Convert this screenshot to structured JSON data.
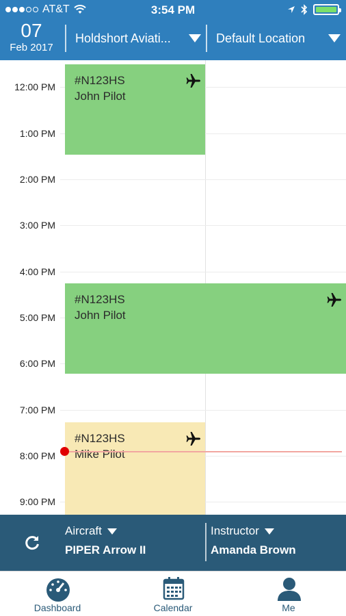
{
  "status_bar": {
    "carrier": "AT&T",
    "time": "3:54 PM"
  },
  "header": {
    "day": "07",
    "month_year": "Feb 2017",
    "org_select": "Holdshort Aviati...",
    "location_select": "Default Location"
  },
  "calendar": {
    "time_labels": [
      "12:00 PM",
      "1:00 PM",
      "2:00 PM",
      "3:00 PM",
      "4:00 PM",
      "5:00 PM",
      "6:00 PM",
      "7:00 PM",
      "8:00 PM",
      "9:00 PM"
    ],
    "events": [
      {
        "tail": "#N123HS",
        "pilot": "John Pilot",
        "color": "#86d07f"
      },
      {
        "tail": "#N123HS",
        "pilot": "John Pilot",
        "color": "#86d07f"
      },
      {
        "tail": "#N123HS",
        "pilot": "Mike Pilot",
        "color": "#f8e9b5"
      }
    ]
  },
  "filters": {
    "aircraft_label": "Aircraft",
    "aircraft_value": "PIPER Arrow II",
    "instructor_label": "Instructor",
    "instructor_value": "Amanda Brown"
  },
  "tabs": [
    {
      "label": "Dashboard",
      "icon": "dashboard-gauge-icon"
    },
    {
      "label": "Calendar",
      "icon": "calendar-icon"
    },
    {
      "label": "Me",
      "icon": "person-icon"
    }
  ],
  "colors": {
    "header_blue": "#2f7fbd",
    "filter_bar": "#2a5a78",
    "event_green": "#86d07f",
    "event_yellow": "#f8e9b5",
    "now_indicator": "#e00000"
  }
}
